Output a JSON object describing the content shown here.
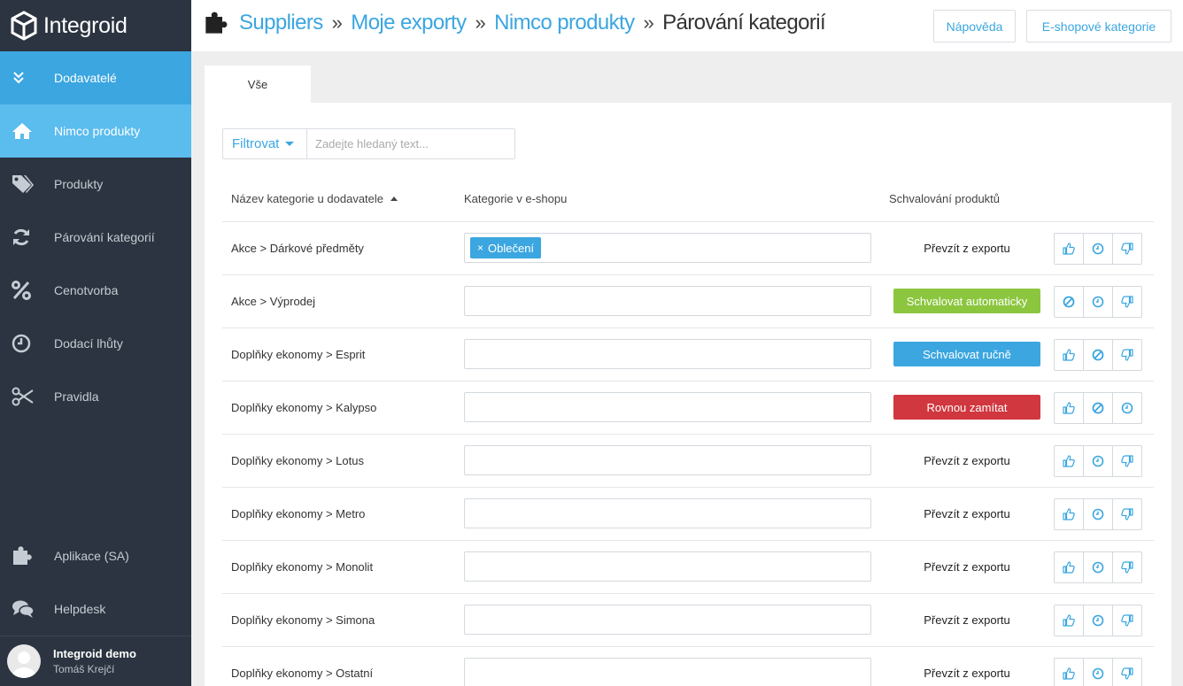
{
  "app": {
    "name": "Integroid"
  },
  "sidebar": {
    "items": [
      {
        "label": "Dodavatelé",
        "icon": "chevron-double-down-icon"
      },
      {
        "label": "Nimco produkty",
        "icon": "home-icon"
      },
      {
        "label": "Produkty",
        "icon": "tags-icon"
      },
      {
        "label": "Párování kategorií",
        "icon": "refresh-icon"
      },
      {
        "label": "Cenotvorba",
        "icon": "percent-icon"
      },
      {
        "label": "Dodací lhůty",
        "icon": "clock-icon"
      },
      {
        "label": "Pravidla",
        "icon": "scissors-icon"
      }
    ],
    "bottom_items": [
      {
        "label": "Aplikace (SA)",
        "icon": "puzzle-icon"
      },
      {
        "label": "Helpdesk",
        "icon": "chat-icon"
      }
    ],
    "user": {
      "name": "Integroid demo",
      "sub": "Tomáš Krejčí"
    }
  },
  "header": {
    "breadcrumb": [
      "Suppliers",
      "Moje exporty",
      "Nimco produkty"
    ],
    "separator": "»",
    "current": "Párování kategorií",
    "help_button": "Nápověda",
    "categories_button": "E-shopové kategorie"
  },
  "tabs": [
    {
      "label": "Vše"
    }
  ],
  "filter": {
    "button": "Filtrovat",
    "placeholder": "Zadejte hledaný text..."
  },
  "table": {
    "columns": [
      "Název kategorie u dodavatele",
      "Kategorie v e-shopu",
      "Schvalování produktů"
    ],
    "rows": [
      {
        "name": "Akce > Dárkové předměty",
        "tag": "Oblečení",
        "status": "Převzít z exportu",
        "status_style": "plain",
        "actions": [
          "thumbs-up-icon",
          "clock-icon",
          "thumbs-down-icon"
        ]
      },
      {
        "name": "Akce > Výprodej",
        "tag": "",
        "status": "Schvalovat automaticky",
        "status_style": "green",
        "actions": [
          "ban-icon",
          "clock-icon",
          "thumbs-down-icon"
        ]
      },
      {
        "name": "Doplňky ekonomy > Esprit",
        "tag": "",
        "status": "Schvalovat ručně",
        "status_style": "blue",
        "actions": [
          "thumbs-up-icon",
          "ban-icon",
          "thumbs-down-icon"
        ]
      },
      {
        "name": "Doplňky ekonomy > Kalypso",
        "tag": "",
        "status": "Rovnou zamítat",
        "status_style": "red",
        "actions": [
          "thumbs-up-icon",
          "ban-icon",
          "clock-icon"
        ]
      },
      {
        "name": "Doplňky ekonomy > Lotus",
        "tag": "",
        "status": "Převzít z exportu",
        "status_style": "plain",
        "actions": [
          "thumbs-up-icon",
          "clock-icon",
          "thumbs-down-icon"
        ]
      },
      {
        "name": "Doplňky ekonomy > Metro",
        "tag": "",
        "status": "Převzít z exportu",
        "status_style": "plain",
        "actions": [
          "thumbs-up-icon",
          "clock-icon",
          "thumbs-down-icon"
        ]
      },
      {
        "name": "Doplňky ekonomy > Monolit",
        "tag": "",
        "status": "Převzít z exportu",
        "status_style": "plain",
        "actions": [
          "thumbs-up-icon",
          "clock-icon",
          "thumbs-down-icon"
        ]
      },
      {
        "name": "Doplňky ekonomy > Simona",
        "tag": "",
        "status": "Převzít z exportu",
        "status_style": "plain",
        "actions": [
          "thumbs-up-icon",
          "clock-icon",
          "thumbs-down-icon"
        ]
      },
      {
        "name": "Doplňky ekonomy > Ostatní",
        "tag": "",
        "status": "Převzít z exportu",
        "status_style": "plain",
        "actions": [
          "thumbs-up-icon",
          "clock-icon",
          "thumbs-down-icon"
        ]
      }
    ]
  },
  "colors": {
    "accent": "#3ba6e0",
    "sidebar": "#2b3440",
    "green": "#8cc63f",
    "red": "#d0373f"
  }
}
